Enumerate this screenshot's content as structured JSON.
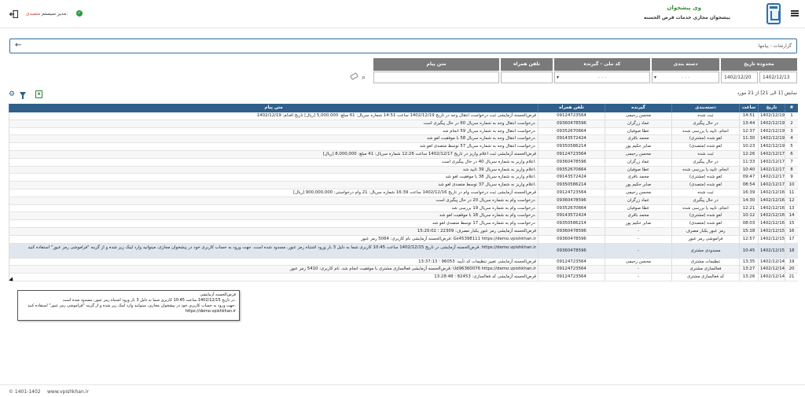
{
  "header": {
    "app_title": "وی پیشخوان",
    "app_subtitle": "پیشخوان مجازی خدمات قرض الحسنه",
    "user_role": "متصدی:",
    "user_name": "مدیر سیستم"
  },
  "breadcrumb": {
    "text": "گزارشات - پیامها"
  },
  "filters": {
    "date_range_label": "محدوده تاریخ",
    "date_from": "1402/12/13",
    "date_to": "1402/12/20",
    "category_label": "دسته بندی",
    "category_value": "- - -",
    "receiver_label": "کد ملی - گیرنده",
    "receiver_value": "- - -",
    "phone_label": "تلفن همراه",
    "phone_value": "",
    "message_label": "متن پیام",
    "message_value": ""
  },
  "pager": {
    "text": "نمایش [1 الی 21] از 21 مورد"
  },
  "table": {
    "headers": {
      "idx": "#",
      "date": "تاریخ",
      "time": "ساعت",
      "category": "دسته‌بندی",
      "receiver": "گیرنده",
      "phone": "تلفن همراه",
      "message": "متن پیام"
    },
    "rows": [
      {
        "idx": "1",
        "date": "1402/12/19",
        "time": "14:51",
        "category": "ثبت شده",
        "receiver": "محسن رحیمی",
        "phone": "09124723564",
        "message": "قرض‌الحسنه آزمایشی ثبت درخواست انتقال وجه در تاریخ 1402/12/19 ساعت 14:51 شماره سریال: 61 مبلغ: 5,000,000 [ریال] تاریخ اقدام: 1402/12/19"
      },
      {
        "idx": "2",
        "date": "1402/12/19",
        "time": "13:44",
        "category": "در حال پیگیری",
        "receiver": "عماد زرگران",
        "phone": "09360478596",
        "message": "درخواست انتقال وجه به شماره سریال 60 در حال پیگیری است."
      },
      {
        "idx": "3",
        "date": "1402/12/19",
        "time": "12:37",
        "category": "انجام، تایید یا بررسی شده",
        "receiver": "عطا صوفیان",
        "phone": "09352670664",
        "message": "درخواست انتقال وجه به شماره سریال 59 انجام شد."
      },
      {
        "idx": "4",
        "date": "1402/12/19",
        "time": "11:30",
        "category": "لغو شده (مشتری)",
        "receiver": "محمد باقری",
        "phone": "09143572424",
        "message": "درخواست انتقال وجه به شماره سریال 58 با موفقیت لغو شد."
      },
      {
        "idx": "5",
        "date": "1402/12/19",
        "time": "10:23",
        "category": "لغو شده (متصدی)",
        "receiver": "صابر حکیم پور",
        "phone": "09350586214",
        "message": "درخواست انتقال وجه به شماره سریال 57 توسط متصدی لغو شد."
      },
      {
        "idx": "6",
        "date": "1402/12/17",
        "time": "12:26",
        "category": "ثبت شده",
        "receiver": "محسن رحیمی",
        "phone": "09124723564",
        "message": "قرض‌الحسنه آزمایشی ثبت اعلام واریز در تاریخ 1402/12/17 ساعت 12:26 شماره سریال: 41 مبلغ: 8,000,000 [ریال]"
      },
      {
        "idx": "7",
        "date": "1402/12/17",
        "time": "11:33",
        "category": "در حال پیگیری",
        "receiver": "عماد زرگران",
        "phone": "09360478596",
        "message": "اعلام واریز به شماره سریال 40 در حال پیگیری است."
      },
      {
        "idx": "8",
        "date": "1402/12/17",
        "time": "10:40",
        "category": "انجام، تایید یا بررسی شده",
        "receiver": "عطا صوفیان",
        "phone": "09352670664",
        "message": "اعلام واریز به شماره سریال 39 تایید شد."
      },
      {
        "idx": "9",
        "date": "1402/12/17",
        "time": "09:47",
        "category": "لغو شده (مشتری)",
        "receiver": "محمد باقری",
        "phone": "09143572424",
        "message": "اعلام واریز به شماره سریال 38 با موفقیت لغو شد."
      },
      {
        "idx": "10",
        "date": "1402/12/17",
        "time": "08:54",
        "category": "لغو شده (متصدی)",
        "receiver": "صابر حکیم پور",
        "phone": "09350586214",
        "message": "اعلام واریز به شماره سریال 37 توسط متصدی لغو شد."
      },
      {
        "idx": "11",
        "date": "1402/12/16",
        "time": "16:39",
        "category": "ثبت شده",
        "receiver": "محسن رحیمی",
        "phone": "09124723564",
        "message": "قرض‌الحسنه آزمایشی ثبت درخواست وام در تاریخ 1402/12/16 ساعت 16:39 شماره سریال: 21 وام درخواستی: 900,000,000 [ریال]"
      },
      {
        "idx": "12",
        "date": "1402/12/16",
        "time": "14:30",
        "category": "در حال پیگیری",
        "receiver": "عماد زرگران",
        "phone": "09360478596",
        "message": "درخواست وام به شماره سریال 20 در حال پیگیری است."
      },
      {
        "idx": "13",
        "date": "1402/12/16",
        "time": "12:21",
        "category": "انجام، تایید یا بررسی شده",
        "receiver": "عطا صوفیان",
        "phone": "09352670664",
        "message": "درخواست وام به شماره سریال 19 بررسی شد."
      },
      {
        "idx": "14",
        "date": "1402/12/16",
        "time": "10:12",
        "category": "لغو شده (مشتری)",
        "receiver": "محمد باقری",
        "phone": "09143572424",
        "message": "درخواست وام به شماره سریال 18 با موفقیت لغو شد."
      },
      {
        "idx": "15",
        "date": "1402/12/16",
        "time": "08:03",
        "category": "لغو شده (متصدی)",
        "receiver": "صابر حکیم پور",
        "phone": "09350586214",
        "message": "درخواست وام به شماره سریال 17 توسط متصدی لغو شد."
      },
      {
        "idx": "16",
        "date": "1402/12/15",
        "time": "15:18",
        "category": "رمز عبور یکبار مصرف",
        "receiver": "-",
        "phone": "09360478596",
        "message": "قرض‌الحسنه آزمایشی رمز عبور یکبار مصرف: 22309 ؛ 15:20:02"
      },
      {
        "idx": "17",
        "date": "1402/12/15",
        "time": "12:57",
        "category": "فراموشی رمز عبور",
        "receiver": "-",
        "phone": "09360478596",
        "message": "قرض‌الحسنه آزمایشی نام کاربری: 5064 رمز عبور: Gs45398111 https://demo.vpishkhan.ir"
      },
      {
        "idx": "18",
        "date": "1402/12/15",
        "time": "10:45",
        "category": "مسدودی مشتری",
        "receiver": "-",
        "phone": "09360478596",
        "message": "قرض‌الحسنه آزمایشی در تاریخ 1402/12/15 ساعت 10:45 کاربری شما به دلیل 3 بار ورود اشتباه رمز عبور، مسدود شده است. جهت ورود به حساب کاربری خود در پیشخوان مجازی، میتوانید وارد لینک زیر شده و از گزینه \"فراموشی رمز عبور\" استفاده کنید. https://demo.vpishkhan.ir"
      },
      {
        "idx": "19",
        "date": "1402/12/14",
        "time": "13:35",
        "category": "تنظیمات مشتری",
        "receiver": "محسن رحیمی",
        "phone": "09124723564",
        "message": "قرض‌الحسنه آزمایشی تغییر تنظیمات کد تأیید: 96053 ؛ 13:37:13"
      },
      {
        "idx": "20",
        "date": "1402/12/14",
        "time": "13:27",
        "category": "فعالسازی مشتری",
        "receiver": "-",
        "phone": "09124723564",
        "message": "قرض‌الحسنه آزمایشی فعالسازی مشتری با موفقیت انجام شد. نام کاربری: 5410 رمز عبور: Ud96360076 https://demo.vpishkhan.ir"
      },
      {
        "idx": "21",
        "date": "1402/12/14",
        "time": "13:26",
        "category": "کد فعالسازی مشتری",
        "receiver": "-",
        "phone": "09124723564",
        "message": "قرض‌الحسنه آزمایشی کد فعالسازی: 82453 ؛ 13:28:48"
      }
    ]
  },
  "tooltip": {
    "line1": "قرض‌الحسنه آزمایشی",
    "line2": "در تاریخ 1402/12/15 ساعت 10:45 کاربری شما به دلیل 3 بار ورود اشتباه رمز عبور، مسدود شده است.",
    "line3": "جهت ورود به حساب کاربری خود در پیشخوان مجازی، میتوانید وارد لینک زیر شده و از گزینه \"فراموشی رمز عبور\" استفاده کنید.",
    "line4": "https://demo.vpishkhan.ir"
  },
  "footer": {
    "copyright": "© 1401-1402",
    "site": "www.vpishkhan.ir"
  },
  "colors": {
    "primary": "#2f5f8a",
    "accent_green": "#3a8a3a",
    "role_red": "#c0392b"
  }
}
